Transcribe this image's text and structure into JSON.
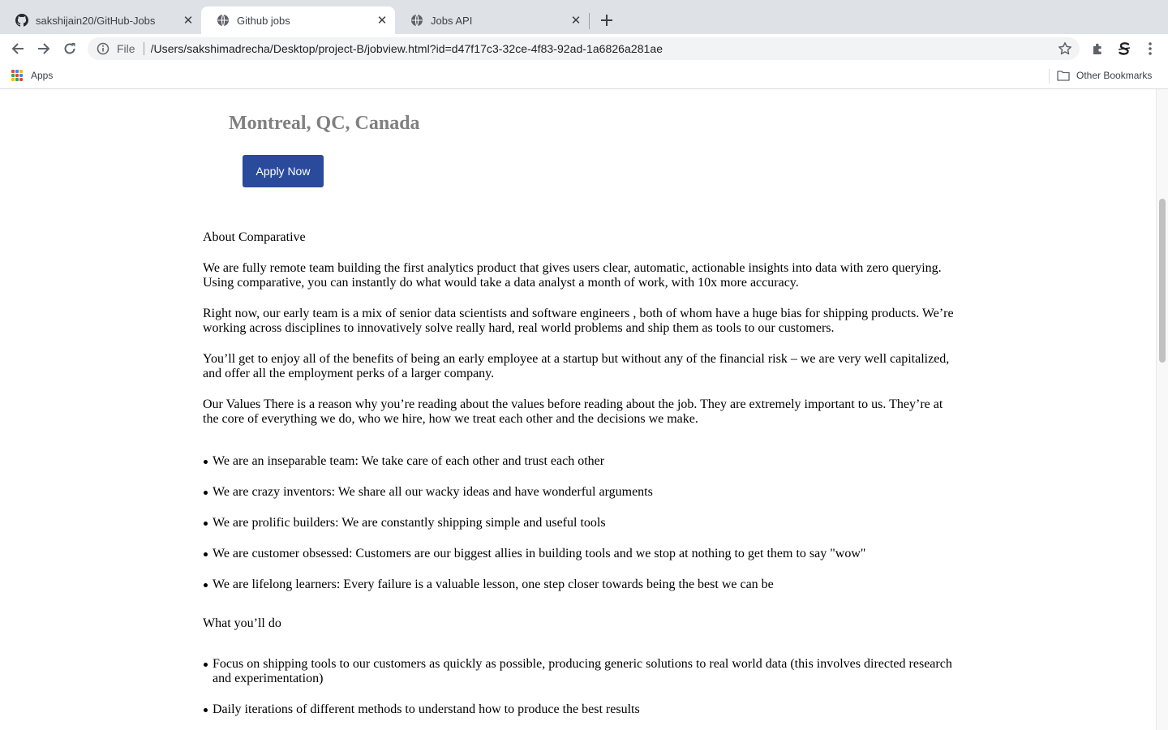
{
  "browser": {
    "tabs": [
      {
        "title": "sakshijain20/GitHub-Jobs",
        "icon": "github-icon",
        "active": false
      },
      {
        "title": "Github jobs",
        "icon": "globe-icon",
        "active": true
      },
      {
        "title": "Jobs API",
        "icon": "globe-icon",
        "active": false
      }
    ],
    "new_tab_icon": "plus-icon",
    "address": {
      "scheme_label": "File",
      "url": "/Users/sakshimadrecha/Desktop/project-B/jobview.html?id=d47f17c3-32ce-4f83-92ad-1a6826a281ae"
    },
    "bookmarks": {
      "apps_label": "Apps",
      "other_label": "Other Bookmarks"
    },
    "colors": {
      "tabstrip": "#dee1e6",
      "omnibox": "#f1f3f4"
    }
  },
  "job": {
    "location": "Montreal, QC, Canada",
    "apply_label": "Apply Now",
    "apply_color": "#2a4a9c",
    "about_heading": "About Comparative",
    "paragraphs": [
      "We are fully remote team building the first analytics product that gives users clear, automatic, actionable insights into data with zero querying. Using comparative, you can instantly do what would take a data analyst a month of work, with 10x more accuracy.",
      "Right now, our early team is a mix of senior data scientists and software engineers , both of whom have a huge bias for shipping products. We’re working across disciplines to innovatively solve really hard, real world problems and ship them as tools to our customers.",
      "You’ll get to enjoy all of the benefits of being an early employee at a startup but without any of the financial risk – we are very well capitalized, and offer all the employment perks of a larger company.",
      "Our Values There is a reason why you’re reading about the values before reading about the job. They are extremely important to us. They’re at the core of everything we do, who we hire, how we treat each other and the decisions we make."
    ],
    "values": [
      "We are an inseparable team: We take care of each other and trust each other",
      "We are crazy inventors: We share all our wacky ideas and have wonderful arguments",
      "We are prolific builders: We are constantly shipping simple and useful tools",
      "We are customer obsessed: Customers are our biggest allies in building tools and we stop at nothing to get them to say \"wow\"",
      "We are lifelong learners: Every failure is a valuable lesson, one step closer towards being the best we can be"
    ],
    "what_heading": "What you’ll do",
    "duties": [
      "Focus on shipping tools to our customers as quickly as possible, producing generic solutions to real world data (this involves directed research and experimentation)",
      "Daily iterations of different methods to understand how to produce the best results"
    ]
  }
}
